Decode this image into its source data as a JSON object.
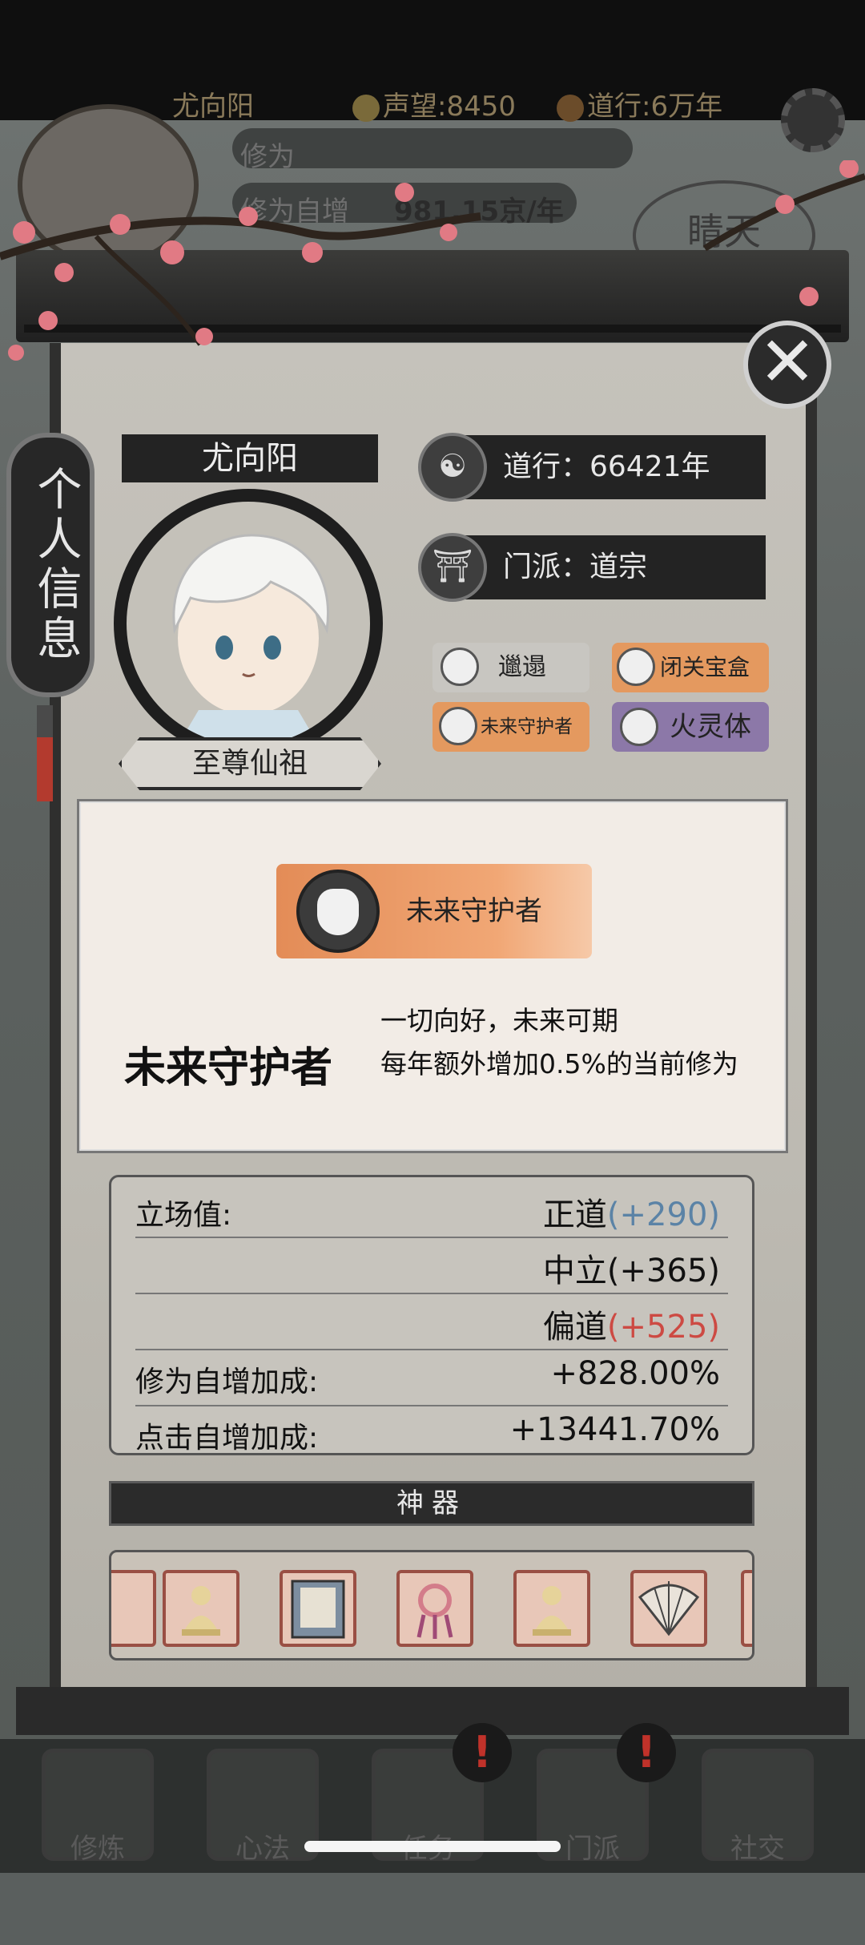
{
  "hud": {
    "player_name": "尤向阳",
    "reputation": "声望:8450",
    "daoxing": "道行:6万年",
    "cultivation_label": "修为",
    "cultivation_increase_label": "修为自增",
    "cultivation_increase_value": "981.15京/年",
    "seal_text": "睛天"
  },
  "panel": {
    "side_tag": "个人信息",
    "name": "尤向阳",
    "title": "至尊仙祖",
    "daoxing": "道行：66421年",
    "sect": "门派：道宗",
    "close_symbol": "✕"
  },
  "traits": [
    {
      "label": "邋遢",
      "color": "#c8c6c1"
    },
    {
      "label": "闭关宝盒",
      "color": "#e4995f"
    },
    {
      "label": "未来守护者",
      "color": "#e4995f"
    },
    {
      "label": "火灵体",
      "color": "#8c78a8"
    }
  ],
  "detail": {
    "banner": "未来守护者",
    "title": "未来守护者",
    "desc_line1": "一切向好，未来可期",
    "desc_line2": "每年额外增加0.5%的当前修为"
  },
  "stats": {
    "stance_label": "立场值:",
    "righteous": "正道",
    "righteous_delta": "(+290)",
    "neutral": "中立(+365)",
    "deviant": "偏道",
    "deviant_delta": "(+525)",
    "cultivation_bonus_label": "修为自增加成:",
    "cultivation_bonus_value": "+828.00%",
    "partial_label": "点击自增加成:",
    "partial_value": "+13441.70%"
  },
  "artifacts": {
    "header": "神器",
    "items": [
      "golden-buddha",
      "scripture-book",
      "jade-pendant",
      "golden-buddha",
      "folding-fan"
    ]
  },
  "tabs": [
    {
      "label": "修炼",
      "alert": false
    },
    {
      "label": "心法",
      "alert": false
    },
    {
      "label": "任务",
      "alert": true
    },
    {
      "label": "门派",
      "alert": true
    },
    {
      "label": "社交",
      "alert": false
    }
  ]
}
